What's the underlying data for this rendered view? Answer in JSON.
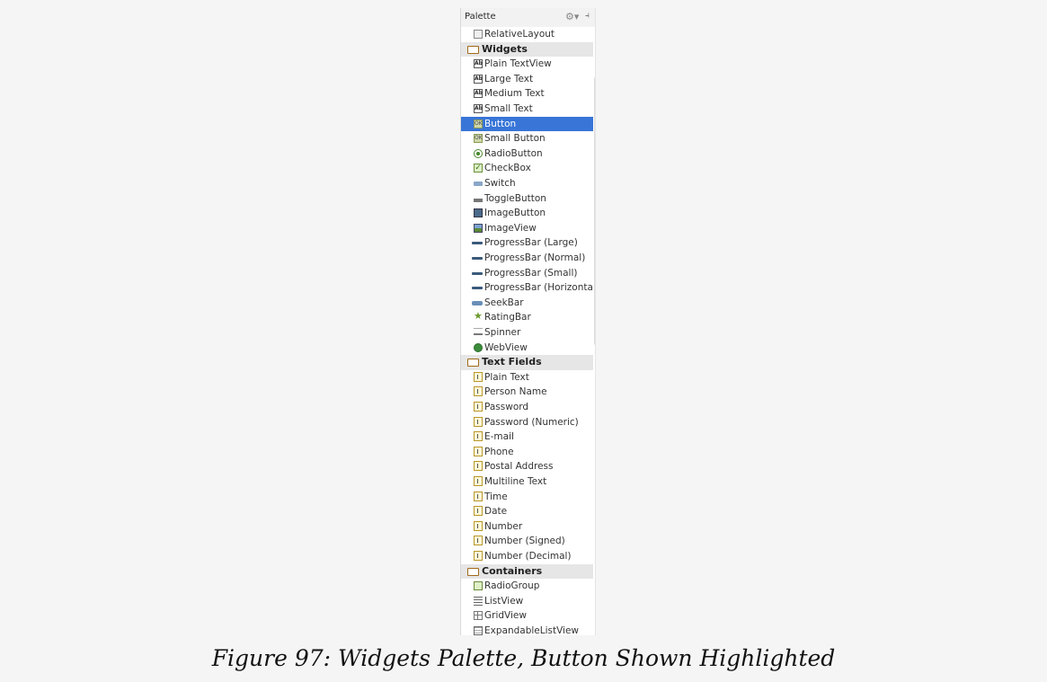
{
  "palette": {
    "title": "Palette",
    "header_icons": [
      "gear-icon",
      "pin-icon"
    ],
    "selected_item": "Button",
    "rows": [
      {
        "type": "item",
        "label": "RelativeLayout",
        "icon": "layout-icon"
      },
      {
        "type": "category",
        "label": "Widgets",
        "icon": "folder-icon"
      },
      {
        "type": "item",
        "label": "Plain TextView",
        "icon": "ab-icon"
      },
      {
        "type": "item",
        "label": "Large Text",
        "icon": "ab-icon"
      },
      {
        "type": "item",
        "label": "Medium Text",
        "icon": "ab-icon"
      },
      {
        "type": "item",
        "label": "Small Text",
        "icon": "ab-icon"
      },
      {
        "type": "item",
        "label": "Button",
        "icon": "ok-icon",
        "selected": true
      },
      {
        "type": "item",
        "label": "Small Button",
        "icon": "ok-icon"
      },
      {
        "type": "item",
        "label": "RadioButton",
        "icon": "radio-icon"
      },
      {
        "type": "item",
        "label": "CheckBox",
        "icon": "check-icon"
      },
      {
        "type": "item",
        "label": "Switch",
        "icon": "switch-icon"
      },
      {
        "type": "item",
        "label": "ToggleButton",
        "icon": "toggle-icon"
      },
      {
        "type": "item",
        "label": "ImageButton",
        "icon": "image-icon"
      },
      {
        "type": "item",
        "label": "ImageView",
        "icon": "imageview-icon"
      },
      {
        "type": "item",
        "label": "ProgressBar (Large)",
        "icon": "progress-icon"
      },
      {
        "type": "item",
        "label": "ProgressBar (Normal)",
        "icon": "progress-icon"
      },
      {
        "type": "item",
        "label": "ProgressBar (Small)",
        "icon": "progress-icon"
      },
      {
        "type": "item",
        "label": "ProgressBar (Horizontal)",
        "icon": "progress-icon"
      },
      {
        "type": "item",
        "label": "SeekBar",
        "icon": "seek-icon"
      },
      {
        "type": "item",
        "label": "RatingBar",
        "icon": "star-icon"
      },
      {
        "type": "item",
        "label": "Spinner",
        "icon": "spinner-icon"
      },
      {
        "type": "item",
        "label": "WebView",
        "icon": "web-icon"
      },
      {
        "type": "category",
        "label": "Text Fields",
        "icon": "folder-icon"
      },
      {
        "type": "item",
        "label": "Plain Text",
        "icon": "field-icon"
      },
      {
        "type": "item",
        "label": "Person Name",
        "icon": "field-icon"
      },
      {
        "type": "item",
        "label": "Password",
        "icon": "field-icon"
      },
      {
        "type": "item",
        "label": "Password (Numeric)",
        "icon": "field-icon"
      },
      {
        "type": "item",
        "label": "E-mail",
        "icon": "field-icon"
      },
      {
        "type": "item",
        "label": "Phone",
        "icon": "field-icon"
      },
      {
        "type": "item",
        "label": "Postal Address",
        "icon": "field-icon"
      },
      {
        "type": "item",
        "label": "Multiline Text",
        "icon": "field-icon"
      },
      {
        "type": "item",
        "label": "Time",
        "icon": "field-icon"
      },
      {
        "type": "item",
        "label": "Date",
        "icon": "field-icon"
      },
      {
        "type": "item",
        "label": "Number",
        "icon": "field-icon"
      },
      {
        "type": "item",
        "label": "Number (Signed)",
        "icon": "field-icon"
      },
      {
        "type": "item",
        "label": "Number (Decimal)",
        "icon": "field-icon"
      },
      {
        "type": "category",
        "label": "Containers",
        "icon": "folder-icon"
      },
      {
        "type": "item",
        "label": "RadioGroup",
        "icon": "radiogroup-icon"
      },
      {
        "type": "item",
        "label": "ListView",
        "icon": "list-icon"
      },
      {
        "type": "item",
        "label": "GridView",
        "icon": "grid-icon"
      },
      {
        "type": "item",
        "label": "ExpandableListView",
        "icon": "expandable-list-icon"
      }
    ]
  },
  "caption": "Figure 97: Widgets Palette, Button Shown Highlighted"
}
